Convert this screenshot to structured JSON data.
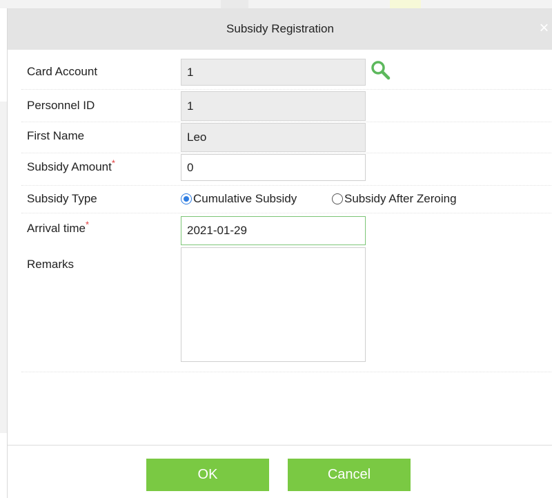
{
  "dialog": {
    "title": "Subsidy Registration",
    "close_symbol": "×"
  },
  "form": {
    "card_account": {
      "label": "Card Account",
      "value": "1"
    },
    "personnel_id": {
      "label": "Personnel ID",
      "value": "1"
    },
    "first_name": {
      "label": "First Name",
      "value": "Leo"
    },
    "subsidy_amount": {
      "label": "Subsidy Amount",
      "value": "0",
      "required_mark": "*"
    },
    "subsidy_type": {
      "label": "Subsidy Type",
      "options": [
        "Cumulative Subsidy",
        "Subsidy After Zeroing"
      ],
      "selected": "Cumulative Subsidy"
    },
    "arrival_time": {
      "label": "Arrival time",
      "value": "2021-01-29",
      "required_mark": "*"
    },
    "remarks": {
      "label": "Remarks",
      "value": ""
    }
  },
  "buttons": {
    "ok": "OK",
    "cancel": "Cancel"
  },
  "icons": {
    "search": "search-icon",
    "close": "close-icon"
  },
  "colors": {
    "header_bg": "#e4e4e4",
    "button_green": "#7ac943",
    "search_icon_green": "#5cb85c",
    "required_red": "#e03b3b",
    "radio_blue": "#2f7de1",
    "active_field_border": "#7cc576"
  }
}
